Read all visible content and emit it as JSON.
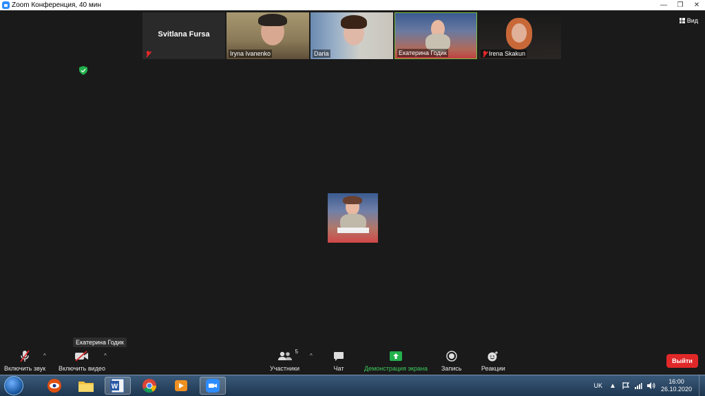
{
  "window": {
    "title": "Zoom Конференция, 40 мин"
  },
  "participants": [
    {
      "name": "Svitlana Fursa",
      "muted": true,
      "video": false
    },
    {
      "name": "Iryna Ivanenko",
      "muted": false,
      "video": true
    },
    {
      "name": "Daria",
      "muted": false,
      "video": true
    },
    {
      "name": "Екатерина Годик",
      "muted": false,
      "video": true,
      "active": true
    },
    {
      "name": "Irena Skakun",
      "muted": true,
      "video": true
    }
  ],
  "view_button": {
    "label": "Вид"
  },
  "speaker": {
    "name": "Екатерина Годик"
  },
  "toolbar": {
    "audio_label": "Включить звук",
    "video_label": "Включить видео",
    "participants_label": "Участники",
    "participants_count": "5",
    "chat_label": "Чат",
    "share_label": "Демонстрация экрана",
    "record_label": "Запись",
    "reactions_label": "Реакции",
    "leave_label": "Выйти"
  },
  "taskbar": {
    "apps": [
      "start-orb",
      "zapper-app",
      "file-explorer",
      "ms-word",
      "google-chrome",
      "media-player",
      "zoom"
    ],
    "language": "UK",
    "time": "16:00",
    "date": "26.10.2020"
  },
  "colors": {
    "background": "#1a1a1a",
    "active_speaker_border": "#7ac142",
    "share_green": "#22b14c",
    "leave_red": "#e02828",
    "muted_red": "#e02828"
  }
}
